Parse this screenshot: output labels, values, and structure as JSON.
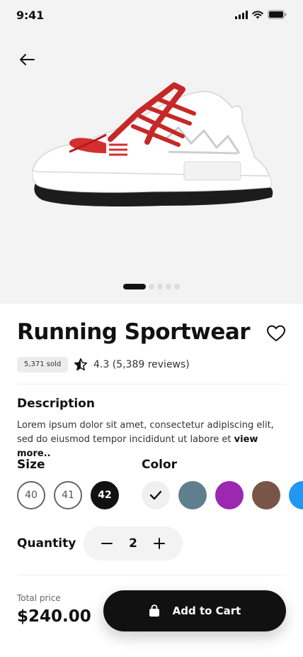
{
  "status_bar": {
    "time": "9:41"
  },
  "product": {
    "title": "Running Sportwear",
    "sold": "5,371 sold",
    "rating": "4.3 (5,389 reviews)",
    "description_heading": "Description",
    "description": "Lorem ipsum dolor sit amet, consectetur adipiscing elit, sed do eiusmod tempor incididunt ut labore et",
    "view_more": "view more.."
  },
  "carousel": {
    "total": 5,
    "active_index": 0
  },
  "size": {
    "heading": "Size",
    "options": [
      "40",
      "41",
      "42"
    ],
    "selected": "42"
  },
  "color": {
    "heading": "Color",
    "swatches": [
      "#f0f0f0",
      "#5f7f8d",
      "#9c27b0",
      "#795548",
      "#2196f3"
    ],
    "selected_index": 0
  },
  "quantity": {
    "heading": "Quantity",
    "value": "2"
  },
  "footer": {
    "total_label": "Total price",
    "total_price": "$240.00",
    "cart_button": "Add to Cart"
  },
  "icons": [
    "signal-icon",
    "wifi-icon",
    "battery-icon",
    "back-arrow-icon",
    "heart-icon",
    "half-star-icon",
    "check-icon",
    "minus-icon",
    "plus-icon",
    "shopping-bag-icon"
  ]
}
